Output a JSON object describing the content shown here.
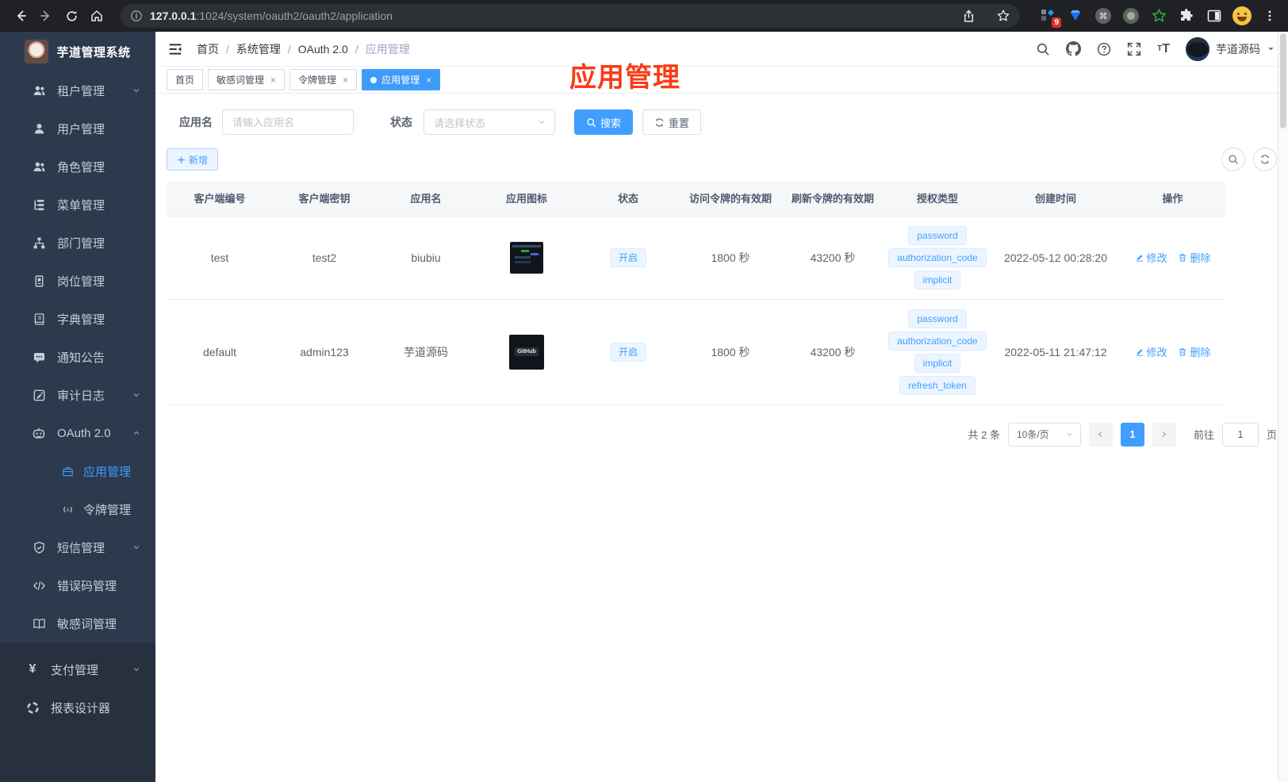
{
  "browser": {
    "url_host": "127.0.0.1",
    "url_path": ":1024/system/oauth2/oauth2/application",
    "extension_badge": "9"
  },
  "sidebar": {
    "app_title": "芋道管理系统",
    "items": [
      {
        "label": "租户管理",
        "icon": "tenant-users-icon"
      },
      {
        "label": "用户管理",
        "icon": "user-icon"
      },
      {
        "label": "角色管理",
        "icon": "role-users-icon"
      },
      {
        "label": "菜单管理",
        "icon": "menu-tree-icon"
      },
      {
        "label": "部门管理",
        "icon": "org-chart-icon"
      },
      {
        "label": "岗位管理",
        "icon": "post-badge-icon"
      },
      {
        "label": "字典管理",
        "icon": "dictionary-icon"
      },
      {
        "label": "通知公告",
        "icon": "notice-icon"
      },
      {
        "label": "审计日志",
        "icon": "audit-log-icon"
      },
      {
        "label": "OAuth 2.0",
        "icon": "oauth-robot-icon"
      },
      {
        "label": "应用管理",
        "icon": "briefcase-icon"
      },
      {
        "label": "令牌管理",
        "icon": "token-signal-icon"
      },
      {
        "label": "短信管理",
        "icon": "shield-icon"
      },
      {
        "label": "错误码管理",
        "icon": "code-icon"
      },
      {
        "label": "敏感词管理",
        "icon": "open-book-icon"
      },
      {
        "label": "支付管理",
        "icon": "yen-icon"
      },
      {
        "label": "报表设计器",
        "icon": "report-icon"
      }
    ]
  },
  "header": {
    "breadcrumb": [
      "首页",
      "系统管理",
      "OAuth 2.0",
      "应用管理"
    ],
    "username": "芋道源码"
  },
  "tabs": [
    {
      "label": "首页"
    },
    {
      "label": "敏感词管理"
    },
    {
      "label": "令牌管理"
    },
    {
      "label": "应用管理"
    }
  ],
  "annotation": {
    "text": "应用管理"
  },
  "filters": {
    "name_label": "应用名",
    "name_placeholder": "请输入应用名",
    "status_label": "状态",
    "status_placeholder": "请选择状态",
    "search_label": "搜索",
    "reset_label": "重置",
    "add_label": "新增"
  },
  "table": {
    "headers": [
      "客户端编号",
      "客户端密钥",
      "应用名",
      "应用图标",
      "状态",
      "访问令牌的有效期",
      "刷新令牌的有效期",
      "授权类型",
      "创建时间",
      "操作"
    ],
    "rows": [
      {
        "client_id": "test",
        "client_secret": "test2",
        "app_name": "biubiu",
        "status": "开启",
        "access_validity": "1800 秒",
        "refresh_validity": "43200 秒",
        "grants": [
          "password",
          "authorization_code",
          "implicit"
        ],
        "created_at": "2022-05-12 00:28:20",
        "actions": [
          "修改",
          "删除"
        ]
      },
      {
        "client_id": "default",
        "client_secret": "admin123",
        "app_name": "芋道源码",
        "icon_text": "GitHub",
        "status": "开启",
        "access_validity": "1800 秒",
        "refresh_validity": "43200 秒",
        "grants": [
          "password",
          "authorization_code",
          "implicit",
          "refresh_token"
        ],
        "created_at": "2022-05-11 21:47:12",
        "actions": [
          "修改",
          "删除"
        ]
      }
    ]
  },
  "pagination": {
    "total": "共 2 条",
    "page_size": "10条/页",
    "current_page": "1",
    "goto_label": "前往",
    "goto_value": "1",
    "unit": "页"
  }
}
